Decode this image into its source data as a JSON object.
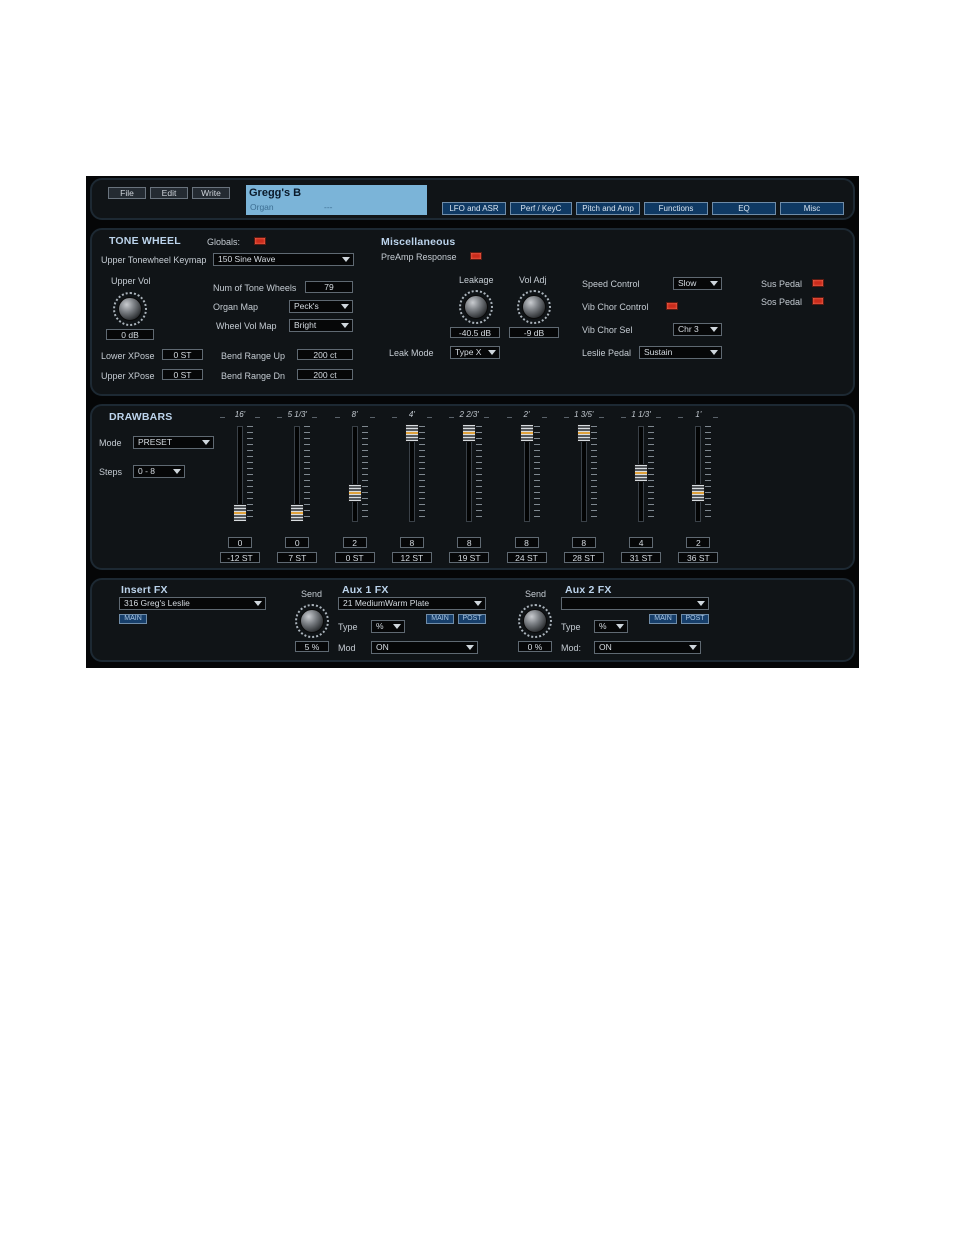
{
  "menu": {
    "file": "File",
    "edit": "Edit",
    "write": "Write"
  },
  "display": {
    "name": "Gregg's B",
    "category": "Organ",
    "extra": "---"
  },
  "nav": [
    "LFO and ASR",
    "Perf / KeyC",
    "Pitch and Amp",
    "Functions",
    "EQ",
    "Misc"
  ],
  "tone_wheel": {
    "title": "TONE WHEEL",
    "globals_label": "Globals:",
    "keymap_label": "Upper Tonewheel Keymap",
    "keymap_value": "150 Sine Wave",
    "upper_vol_label": "Upper Vol",
    "upper_vol_value": "0 dB",
    "num_wheels_label": "Num of Tone Wheels",
    "num_wheels_value": "79",
    "organ_map_label": "Organ Map",
    "organ_map_value": "Peck's",
    "wheel_vol_label": "Wheel Vol Map",
    "wheel_vol_value": "Bright",
    "lower_xpose_label": "Lower XPose",
    "lower_xpose_value": "0 ST",
    "upper_xpose_label": "Upper XPose",
    "upper_xpose_value": "0 ST",
    "bend_up_label": "Bend Range Up",
    "bend_up_value": "200 ct",
    "bend_dn_label": "Bend Range Dn",
    "bend_dn_value": "200 ct"
  },
  "misc": {
    "title": "Miscellaneous",
    "preamp_label": "PreAmp Response",
    "leakage_label": "Leakage",
    "leakage_value": "-40.5 dB",
    "vol_adj_label": "Vol Adj",
    "vol_adj_value": "-9 dB",
    "leak_mode_label": "Leak Mode",
    "leak_mode_value": "Type X",
    "speed_label": "Speed Control",
    "speed_value": "Slow",
    "vib_ctrl_label": "Vib Chor Control",
    "vib_sel_label": "Vib Chor Sel",
    "vib_sel_value": "Chr 3",
    "leslie_label": "Leslie Pedal",
    "leslie_value": "Sustain",
    "sus_label": "Sus Pedal",
    "sos_label": "Sos Pedal"
  },
  "drawbars": {
    "title": "DRAWBARS",
    "mode_label": "Mode",
    "mode_value": "PRESET",
    "steps_label": "Steps",
    "steps_value": "0 - 8",
    "bars": [
      {
        "footage": "16'",
        "level": 0,
        "value": "0",
        "semitone": "-12 ST"
      },
      {
        "footage": "5 1/3'",
        "level": 0,
        "value": "0",
        "semitone": "7 ST"
      },
      {
        "footage": "8'",
        "level": 2,
        "value": "2",
        "semitone": "0 ST"
      },
      {
        "footage": "4'",
        "level": 8,
        "value": "8",
        "semitone": "12 ST"
      },
      {
        "footage": "2 2/3'",
        "level": 8,
        "value": "8",
        "semitone": "19 ST"
      },
      {
        "footage": "2'",
        "level": 8,
        "value": "8",
        "semitone": "24 ST"
      },
      {
        "footage": "1 3/5'",
        "level": 8,
        "value": "8",
        "semitone": "28 ST"
      },
      {
        "footage": "1 1/3'",
        "level": 4,
        "value": "4",
        "semitone": "31 ST"
      },
      {
        "footage": "1'",
        "level": 2,
        "value": "2",
        "semitone": "36 ST"
      }
    ]
  },
  "fx": {
    "insert_title": "Insert FX",
    "insert_value": "316  Greg's Leslie",
    "main_tag": "MAIN",
    "post_tag": "POST",
    "send_label": "Send",
    "aux1_title": "Aux 1 FX",
    "aux1_value": "21  MediumWarm Plate",
    "aux1_send": "5 %",
    "aux1_type_label": "Type",
    "aux1_type_value": "%",
    "aux1_mod_label": "Mod",
    "aux1_mod_value": "ON",
    "aux2_title": "Aux 2 FX",
    "aux2_value": "",
    "aux2_send": "0 %",
    "aux2_type_label": "Type",
    "aux2_type_value": "%",
    "aux2_mod_label": "Mod:",
    "aux2_mod_value": "ON"
  }
}
